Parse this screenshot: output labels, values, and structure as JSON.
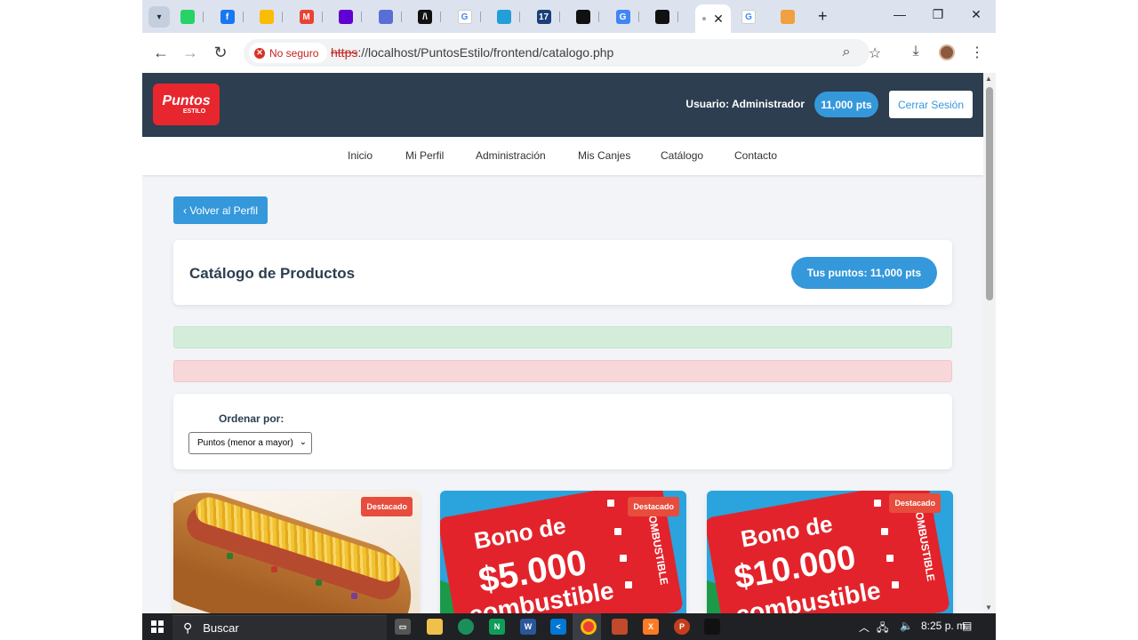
{
  "browser": {
    "tabs": [
      {
        "icon": "whatsapp-icon",
        "color": "#25d366",
        "glyph": ""
      },
      {
        "icon": "facebook-icon",
        "color": "#1877f2",
        "glyph": "f"
      },
      {
        "icon": "google-drive-icon",
        "color": "#fbbc04",
        "glyph": ""
      },
      {
        "icon": "gmail-icon",
        "color": "#ea4335",
        "glyph": "M"
      },
      {
        "icon": "yahoo-mail-icon",
        "color": "#6001d2",
        "glyph": ""
      },
      {
        "icon": "swirl-icon",
        "color": "#5a6fd6",
        "glyph": ""
      },
      {
        "icon": "terminal-icon",
        "color": "#111111",
        "glyph": "/\\"
      },
      {
        "icon": "google-icon",
        "color": "#ffffff",
        "glyph": "G"
      },
      {
        "icon": "telegram-icon",
        "color": "#229ed9",
        "glyph": ""
      },
      {
        "icon": "calendar-icon",
        "color": "#1a3f7a",
        "glyph": "17"
      },
      {
        "icon": "github-icon",
        "color": "#111111",
        "glyph": ""
      },
      {
        "icon": "translate-icon",
        "color": "#4285f4",
        "glyph": "G"
      },
      {
        "icon": "github-icon",
        "color": "#111111",
        "glyph": ""
      }
    ],
    "after_tabs": [
      {
        "icon": "google-icon",
        "color": "#ffffff",
        "glyph": "G"
      },
      {
        "icon": "pma-icon",
        "color": "#f0a040",
        "glyph": ""
      }
    ],
    "insecure_label": "No seguro",
    "url_protocol": "https",
    "url_rest": "://localhost/PuntosEstilo/frontend/catalogo.php"
  },
  "site": {
    "logo_line1": "Puntos",
    "logo_line2": "ESTILO",
    "user_label": "Usuario: Administrador",
    "header_points": "11,000 pts",
    "logout_label": "Cerrar Sesión",
    "nav": [
      "Inicio",
      "Mi Perfil",
      "Administración",
      "Mis Canjes",
      "Catálogo",
      "Contacto"
    ]
  },
  "page": {
    "back_label": "‹ Volver al Perfil",
    "catalog_title": "Catálogo de Productos",
    "my_points": "Tus puntos: 11,000 pts",
    "sort_label": "Ordenar por:",
    "sort_value": "Puntos (menor a mayor)",
    "products": [
      {
        "badge": "Destacado",
        "image": "hotdog"
      },
      {
        "badge": "Destacado",
        "image": "voucher",
        "line1": "Bono de",
        "line2": "$5.000",
        "line3": "combustible",
        "side": "COMBUSTIBLE"
      },
      {
        "badge": "Destacado",
        "image": "voucher",
        "line1": "Bono de",
        "line2": "$10.000",
        "line3": "combustible",
        "side": "COMBUSTIBLE"
      }
    ]
  },
  "taskbar": {
    "search_placeholder": "Buscar",
    "time": "8:25 p. m."
  }
}
